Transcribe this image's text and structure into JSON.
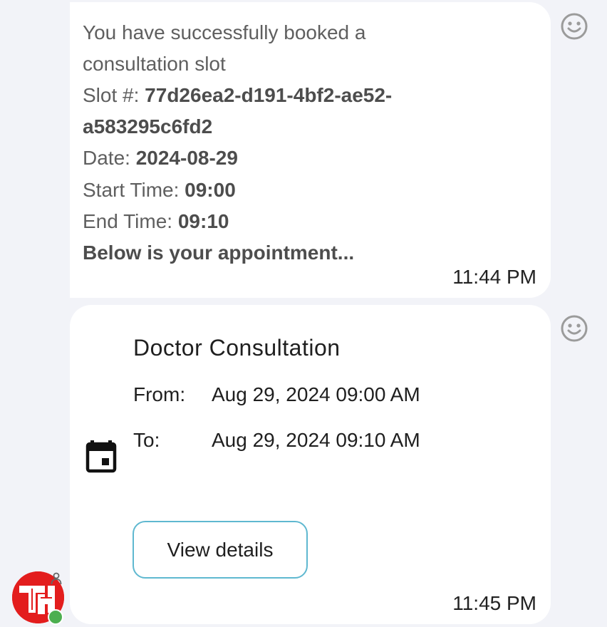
{
  "message1": {
    "line1": "You have successfully booked a",
    "line2": "consultation slot",
    "slot_label": "Slot #: ",
    "slot_value_line1": "77d26ea2-d191-4bf2-ae52-",
    "slot_value_line2": "a583295c6fd2",
    "date_label": "Date: ",
    "date_value": "2024-08-29",
    "start_label": "Start Time: ",
    "start_value": "09:00",
    "end_label": "End Time: ",
    "end_value": "09:10",
    "footer": "Below is your appointment...",
    "time": "11:44 PM"
  },
  "message2": {
    "title": "Doctor Consultation",
    "from_label": "From:",
    "from_value": "Aug 29, 2024 09:00 AM",
    "to_label": "To:",
    "to_value": "Aug 29, 2024 09:10 AM",
    "button_label": "View details",
    "time": "11:45 PM"
  },
  "icons": {
    "reaction": "smiley-face-icon",
    "calendar": "calendar-event-icon",
    "avatar": "avatar-logo",
    "online": "online-status-dot"
  },
  "colors": {
    "background": "#f2f3f8",
    "bubble": "#ffffff",
    "button_border": "#5fb8d0",
    "avatar": "#e31d1d",
    "online": "#4caf50"
  }
}
